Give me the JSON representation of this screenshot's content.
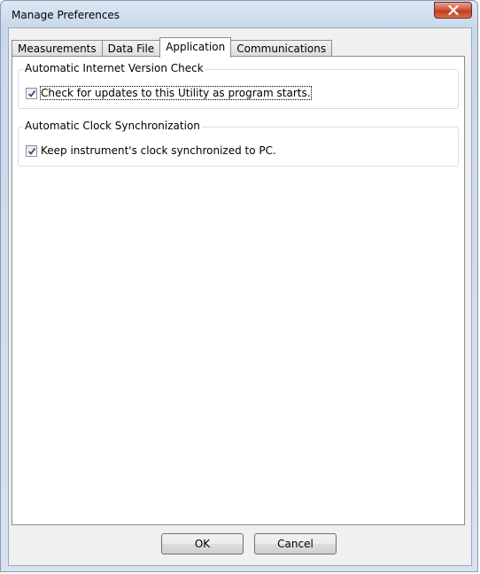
{
  "window": {
    "title": "Manage Preferences"
  },
  "tabs": [
    {
      "label": "Measurements",
      "active": false
    },
    {
      "label": "Data File",
      "active": false
    },
    {
      "label": "Application",
      "active": true
    },
    {
      "label": "Communications",
      "active": false
    }
  ],
  "groups": [
    {
      "legend": "Automatic Internet Version Check",
      "checkbox_label": "Check for updates to this Utility as program starts.",
      "checked": true
    },
    {
      "legend": "Automatic Clock Synchronization",
      "checkbox_label": "Keep instrument's clock synchronized to PC.",
      "checked": true
    }
  ],
  "buttons": {
    "ok_label": "OK",
    "cancel_label": "Cancel"
  },
  "icons": {
    "close": "close-icon",
    "check": "checkmark-icon"
  },
  "colors": {
    "close_button": "#c94a2e",
    "title_bar": "#c9d9ec",
    "checkmark": "#2a4a8a"
  }
}
